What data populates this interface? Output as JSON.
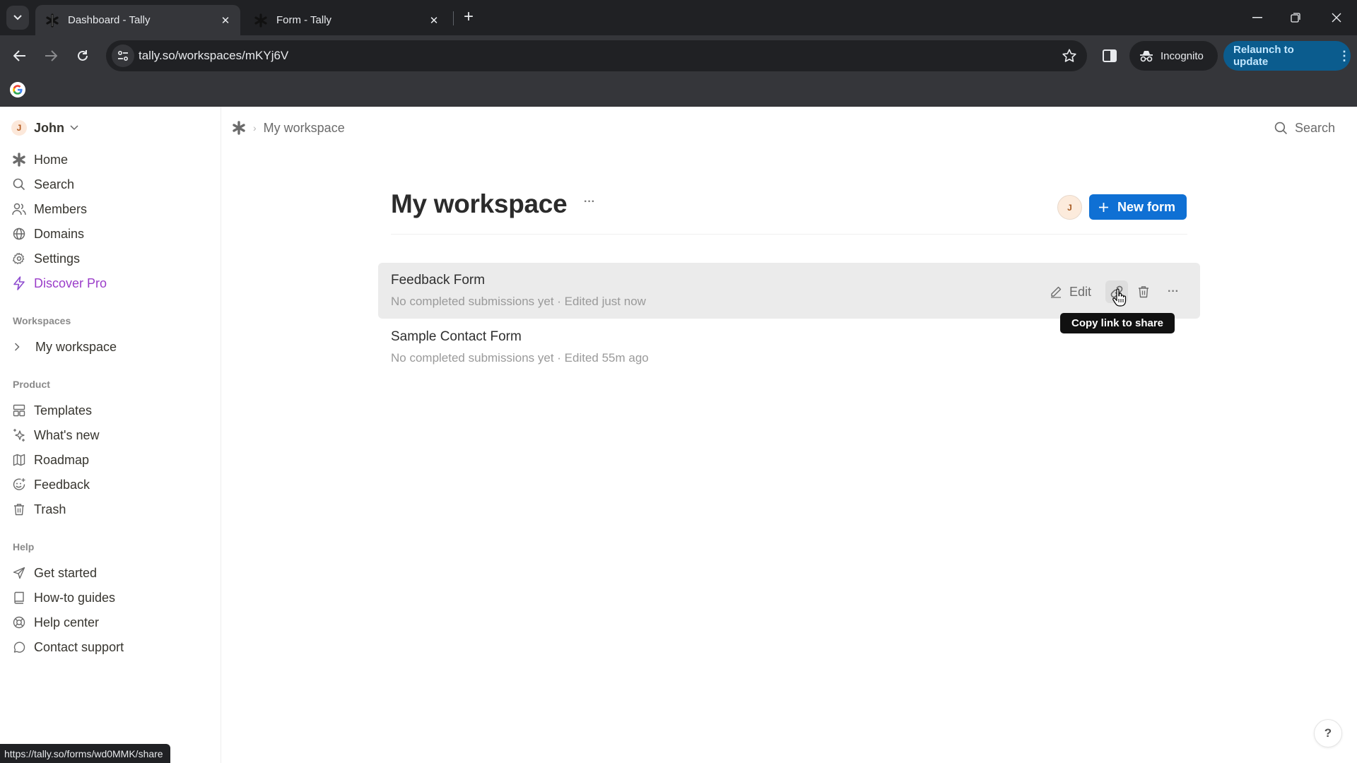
{
  "browser": {
    "tabs": [
      {
        "label": "Dashboard - Tally",
        "active": true
      },
      {
        "label": "Form - Tally",
        "active": false
      }
    ],
    "new_tab_label": "+",
    "url": "tally.so/workspaces/mKYj6V",
    "incognito_label": "Incognito",
    "relaunch_label": "Relaunch to update",
    "status_url": "https://tally.so/forms/wd0MMK/share"
  },
  "sidebar": {
    "user": {
      "initial": "J",
      "name": "John"
    },
    "main_items": [
      {
        "label": "Home",
        "icon": "tally-logo-icon"
      },
      {
        "label": "Search",
        "icon": "search-icon"
      },
      {
        "label": "Members",
        "icon": "members-icon"
      },
      {
        "label": "Domains",
        "icon": "globe-icon"
      },
      {
        "label": "Settings",
        "icon": "gear-icon"
      },
      {
        "label": "Discover Pro",
        "icon": "lightning-icon"
      }
    ],
    "workspaces_heading": "Workspaces",
    "workspaces": [
      {
        "label": "My workspace"
      }
    ],
    "product_heading": "Product",
    "product_items": [
      {
        "label": "Templates",
        "icon": "templates-icon"
      },
      {
        "label": "What's new",
        "icon": "sparkles-icon"
      },
      {
        "label": "Roadmap",
        "icon": "map-icon"
      },
      {
        "label": "Feedback",
        "icon": "smiley-icon"
      },
      {
        "label": "Trash",
        "icon": "trash-icon"
      }
    ],
    "help_heading": "Help",
    "help_items": [
      {
        "label": "Get started",
        "icon": "send-icon"
      },
      {
        "label": "How-to guides",
        "icon": "book-icon"
      },
      {
        "label": "Help center",
        "icon": "lifebuoy-icon"
      },
      {
        "label": "Contact support",
        "icon": "chat-icon"
      }
    ]
  },
  "header": {
    "breadcrumb": [
      "My workspace"
    ],
    "search_label": "Search"
  },
  "workspace": {
    "title": "My workspace",
    "more_label": "···",
    "owner_initial": "J",
    "new_form_label": "New form",
    "forms": [
      {
        "title": "Feedback Form",
        "subtitle": "No completed submissions yet · Edited just now",
        "hovered": true
      },
      {
        "title": "Sample Contact Form",
        "subtitle": "No completed submissions yet · Edited 55m ago",
        "hovered": false
      }
    ],
    "row_actions": {
      "edit_label": "Edit",
      "more_label": "···"
    },
    "tooltip": "Copy link to share"
  },
  "help_button_label": "?",
  "colors": {
    "accent": "#0f70d4",
    "pro": "#9b3dc9",
    "relaunch_bg": "#0b5c8e"
  }
}
